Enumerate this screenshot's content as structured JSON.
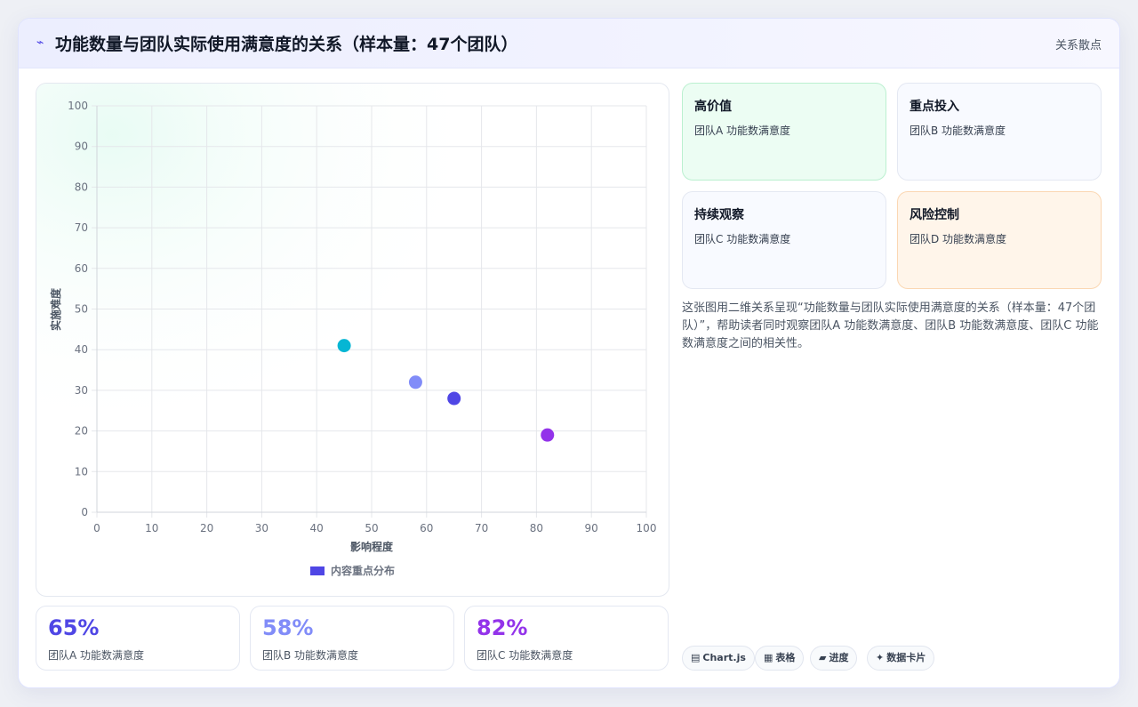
{
  "header": {
    "title_icon": "chart-line-icon",
    "title": "功能数量与团队实际使用满意度的关系（样本量：47个团队）",
    "tag": "关系散点"
  },
  "quadrants": [
    {
      "title": "高价值",
      "subtitle": "团队A 功能数满意度",
      "bg": "#ecfdf3"
    },
    {
      "title": "重点投入",
      "subtitle": "团队B 功能数满意度",
      "bg": "#f8faff"
    },
    {
      "title": "持续观察",
      "subtitle": "团队C 功能数满意度",
      "bg": "#f8faff"
    },
    {
      "title": "风险控制",
      "subtitle": "团队D 功能数满意度",
      "bg": "#fff5ea"
    }
  ],
  "description": "这张图用二维关系呈现“功能数量与团队实际使用满意度的关系（样本量：47个团队）”，帮助读者同时观察团队A 功能数满意度、团队B 功能数满意度、团队C 功能数满意度之间的相关性。",
  "stats": [
    {
      "value": "65%",
      "label": "团队A 功能数满意度",
      "color": "#4f46e5"
    },
    {
      "value": "58%",
      "label": "团队B 功能数满意度",
      "color": "#818cf8"
    },
    {
      "value": "82%",
      "label": "团队C 功能数满意度",
      "color": "#9333ea"
    }
  ],
  "chips": [
    {
      "icon": "chart-icon",
      "glyph": "▤",
      "label": "Chart.js"
    },
    {
      "icon": "table-icon",
      "glyph": "▦",
      "label": "表格"
    },
    {
      "icon": "progress-icon",
      "glyph": "▰",
      "label": "进度"
    },
    {
      "icon": "data-card-icon",
      "glyph": "✦",
      "label": "数据卡片"
    }
  ],
  "chart_data": {
    "type": "scatter",
    "xlabel": "影响程度",
    "ylabel": "实施难度",
    "xlim": [
      0,
      100
    ],
    "ylim": [
      0,
      100
    ],
    "xticks": [
      0,
      10,
      20,
      30,
      40,
      50,
      60,
      70,
      80,
      90,
      100
    ],
    "yticks": [
      0,
      10,
      20,
      30,
      40,
      50,
      60,
      70,
      80,
      90,
      100
    ],
    "grid": true,
    "legend": "bottom",
    "series": [
      {
        "name": "内容重点分布",
        "legend_color": "#4f46e5",
        "points": [
          {
            "x": 45,
            "y": 41,
            "color": "#06b6d4"
          },
          {
            "x": 58,
            "y": 32,
            "color": "#818cf8"
          },
          {
            "x": 65,
            "y": 28,
            "color": "#4f46e5"
          },
          {
            "x": 82,
            "y": 19,
            "color": "#9333ea"
          }
        ]
      }
    ]
  }
}
